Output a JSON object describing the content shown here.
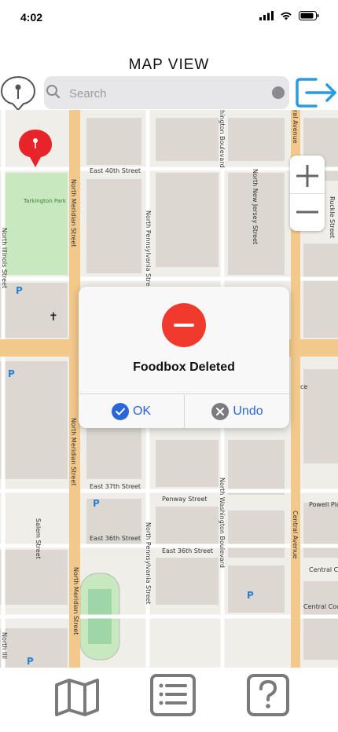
{
  "status_bar": {
    "time": "4:02"
  },
  "header": {
    "title": "MAP VIEW"
  },
  "search": {
    "placeholder": "Search",
    "value": ""
  },
  "map": {
    "labels": {
      "east_40th": "East 40th Street",
      "east_37th": "East 37th Street",
      "east_36th": "East 36th Street",
      "east_36th_b": "East 36th Street",
      "penway": "Penway Street",
      "north_meridian": "North Meridian Street",
      "north_meridian_b": "North Meridian Street",
      "north_meridian_c": "North Meridian Street",
      "north_pennsylvania": "North Pennsylvania Street",
      "north_pennsylvania_b": "North Pennsylvania Street",
      "north_washington": "North Washington Boulevard",
      "washington_top": "hington Boulevard",
      "north_new_jersey": "North New Jersey Street",
      "central_avenue": "Central Avenue",
      "central_avenue_top": "ral Avenue",
      "north_illinois": "North Illinois Street",
      "north_illi_bottom": "North Illi",
      "salem": "Salem Street",
      "ruckle": "Ruckle Street",
      "powell": "Powell Plac",
      "central_court": "Central Court",
      "central_court_b": "Central Court S",
      "tarkington": "Tarkington\nPark",
      "ce": "ce"
    },
    "accent_colors": {
      "major_road": "#f3c98b",
      "park": "#c8e8c0",
      "pin": "#e8232a"
    }
  },
  "dialog": {
    "message": "Foodbox Deleted",
    "ok_label": "OK",
    "undo_label": "Undo"
  },
  "tab_bar": {
    "icons": [
      "map-icon",
      "list-icon",
      "help-icon"
    ]
  }
}
